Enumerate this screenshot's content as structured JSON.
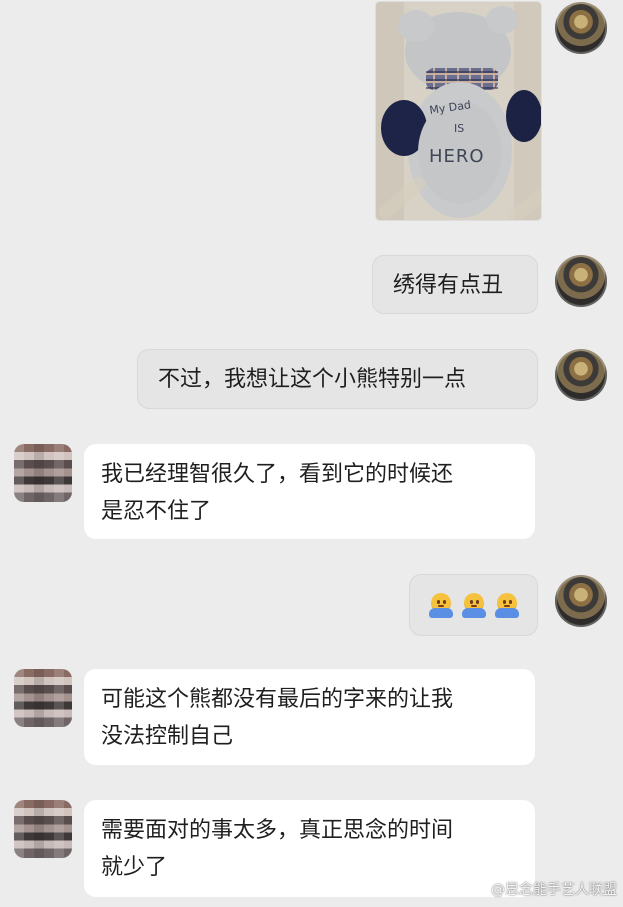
{
  "photo": {
    "embroidery": {
      "line1": "My Dad",
      "line2": "IS",
      "line3": "HERO"
    }
  },
  "messages": [
    {
      "text": "绣得有点丑"
    },
    {
      "text": "不过，我想让这个小熊特别一点"
    },
    {
      "text": "我已经理智很久了，看到它的时候还\n是忍不住了"
    },
    {
      "text": "可能这个熊都没有最后的字来的让我\n没法控制自己"
    },
    {
      "text": "需要面对的事太多，真正思念的时间\n就少了"
    }
  ],
  "watermark": {
    "text": "@思念能手艺人联盟"
  }
}
